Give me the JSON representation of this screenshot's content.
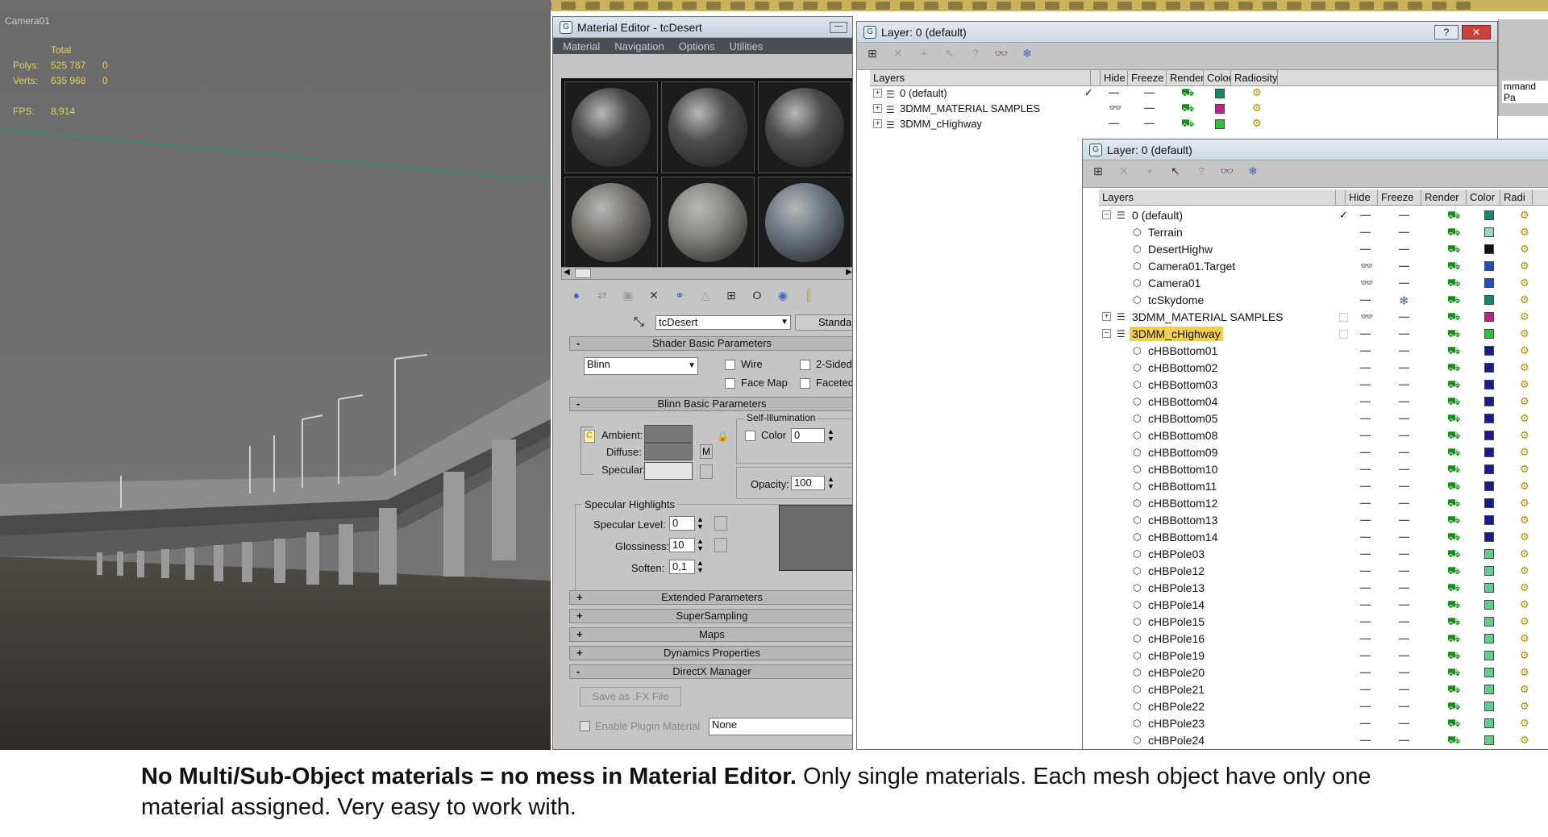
{
  "viewport": {
    "camera_label": "Camera01",
    "stats": {
      "total_label": "Total",
      "polys_label": "Polys:",
      "polys_value": "525 787",
      "polys_sel": "0",
      "verts_label": "Verts:",
      "verts_value": "635 968",
      "verts_sel": "0",
      "fps_label": "FPS:",
      "fps_value": "8,914"
    }
  },
  "material_editor": {
    "title": "Material Editor - tcDesert",
    "menu": [
      "Material",
      "Navigation",
      "Options",
      "Utilities"
    ],
    "material_name": "tcDesert",
    "material_type": "Standa",
    "shader_rollout": "Shader Basic Parameters",
    "shader_value": "Blinn",
    "wire_label": "Wire",
    "two_sided_label": "2-Sided",
    "face_map_label": "Face Map",
    "faceted_label": "Faceted",
    "blinn_rollout": "Blinn Basic Parameters",
    "self_illum_label": "Self-Illumination",
    "color_label": "Color",
    "color_value": "0",
    "ambient_label": "Ambient:",
    "diffuse_label": "Diffuse:",
    "specular_label": "Specular:",
    "m_label": "M",
    "opacity_label": "Opacity:",
    "opacity_value": "100",
    "spec_highlights_label": "Specular Highlights",
    "spec_level_label": "Specular Level:",
    "spec_level_value": "0",
    "glossiness_label": "Glossiness:",
    "glossiness_value": "10",
    "soften_label": "Soften:",
    "soften_value": "0,1",
    "rollouts": [
      {
        "sign": "+",
        "label": "Extended Parameters"
      },
      {
        "sign": "+",
        "label": "SuperSampling"
      },
      {
        "sign": "+",
        "label": "Maps"
      },
      {
        "sign": "+",
        "label": "Dynamics Properties"
      },
      {
        "sign": "-",
        "label": "DirectX Manager"
      }
    ],
    "save_fx_label": "Save as .FX File",
    "enable_plugin_label": "Enable Plugin Material",
    "plugin_value": "None",
    "sphere_colors": [
      "#4a4a4a",
      "#4f4f4f",
      "#4c4c4c",
      "#7a7771",
      "#8a8882",
      "#6e7a88"
    ]
  },
  "layer_back": {
    "title": "Layer: 0 (default)",
    "headers": [
      "Layers",
      "Hide",
      "Freeze",
      "Render",
      "Color",
      "Radiosity"
    ],
    "rows": [
      {
        "name": "0 (default)",
        "current": "✓",
        "hide": "—",
        "freeze": "—",
        "color": "#138a6a"
      },
      {
        "name": "3DMM_MATERIAL SAMPLES",
        "hide": "👓",
        "freeze": "—",
        "color": "#c0208a"
      },
      {
        "name": "3DMM_cHighway",
        "hide": "—",
        "freeze": "—",
        "color": "#2fbf3a"
      }
    ]
  },
  "layer_front": {
    "title": "Layer: 0 (default)",
    "headers": [
      "Layers",
      "Hide",
      "Freeze",
      "Render",
      "Color",
      "Radi"
    ],
    "rows": [
      {
        "name": "0 (default)",
        "level": 0,
        "exp": "−",
        "current": "✓",
        "hide": "—",
        "freeze": "—",
        "color": "#138a6a"
      },
      {
        "name": "Terrain",
        "level": 1,
        "hide": "—",
        "freeze": "—",
        "color": "#9ed9c8"
      },
      {
        "name": "DesertHighw",
        "level": 1,
        "hide": "—",
        "freeze": "—",
        "color": "#111111"
      },
      {
        "name": "Camera01.Target",
        "level": 1,
        "hide": "👓",
        "freeze": "—",
        "color": "#1f4fc4"
      },
      {
        "name": "Camera01",
        "level": 1,
        "hide": "👓",
        "freeze": "—",
        "color": "#1f4fc4"
      },
      {
        "name": "tcSkydome",
        "level": 1,
        "hide": "—",
        "freeze": "❄",
        "color": "#138a6a"
      },
      {
        "name": "3DMM_MATERIAL SAMPLES",
        "level": 0,
        "exp": "+",
        "hide": "👓",
        "freeze": "—",
        "color": "#c0208a"
      },
      {
        "name": "3DMM_cHighway",
        "level": 0,
        "exp": "−",
        "hide": "—",
        "freeze": "—",
        "color": "#2fbf3a",
        "selected": true
      },
      {
        "name": "cHBBottom01",
        "level": 1,
        "hide": "—",
        "freeze": "—",
        "color": "#1a1a8a"
      },
      {
        "name": "cHBBottom02",
        "level": 1,
        "hide": "—",
        "freeze": "—",
        "color": "#1a1a8a"
      },
      {
        "name": "cHBBottom03",
        "level": 1,
        "hide": "—",
        "freeze": "—",
        "color": "#1a1a8a"
      },
      {
        "name": "cHBBottom04",
        "level": 1,
        "hide": "—",
        "freeze": "—",
        "color": "#1a1a8a"
      },
      {
        "name": "cHBBottom05",
        "level": 1,
        "hide": "—",
        "freeze": "—",
        "color": "#1a1a8a"
      },
      {
        "name": "cHBBottom08",
        "level": 1,
        "hide": "—",
        "freeze": "—",
        "color": "#1a1a8a"
      },
      {
        "name": "cHBBottom09",
        "level": 1,
        "hide": "—",
        "freeze": "—",
        "color": "#1a1a8a"
      },
      {
        "name": "cHBBottom10",
        "level": 1,
        "hide": "—",
        "freeze": "—",
        "color": "#1a1a8a"
      },
      {
        "name": "cHBBottom11",
        "level": 1,
        "hide": "—",
        "freeze": "—",
        "color": "#1a1a8a"
      },
      {
        "name": "cHBBottom12",
        "level": 1,
        "hide": "—",
        "freeze": "—",
        "color": "#1a1a8a"
      },
      {
        "name": "cHBBottom13",
        "level": 1,
        "hide": "—",
        "freeze": "—",
        "color": "#1a1a8a"
      },
      {
        "name": "cHBBottom14",
        "level": 1,
        "hide": "—",
        "freeze": "—",
        "color": "#1a1a8a"
      },
      {
        "name": "cHBPole03",
        "level": 1,
        "hide": "—",
        "freeze": "—",
        "color": "#5fd08a"
      },
      {
        "name": "cHBPole12",
        "level": 1,
        "hide": "—",
        "freeze": "—",
        "color": "#5fd08a"
      },
      {
        "name": "cHBPole13",
        "level": 1,
        "hide": "—",
        "freeze": "—",
        "color": "#5fd08a"
      },
      {
        "name": "cHBPole14",
        "level": 1,
        "hide": "—",
        "freeze": "—",
        "color": "#5fd08a"
      },
      {
        "name": "cHBPole15",
        "level": 1,
        "hide": "—",
        "freeze": "—",
        "color": "#5fd08a"
      },
      {
        "name": "cHBPole16",
        "level": 1,
        "hide": "—",
        "freeze": "—",
        "color": "#5fd08a"
      },
      {
        "name": "cHBPole19",
        "level": 1,
        "hide": "—",
        "freeze": "—",
        "color": "#5fd08a"
      },
      {
        "name": "cHBPole20",
        "level": 1,
        "hide": "—",
        "freeze": "—",
        "color": "#5fd08a"
      },
      {
        "name": "cHBPole21",
        "level": 1,
        "hide": "—",
        "freeze": "—",
        "color": "#5fd08a"
      },
      {
        "name": "cHBPole22",
        "level": 1,
        "hide": "—",
        "freeze": "—",
        "color": "#5fd08a"
      },
      {
        "name": "cHBPole23",
        "level": 1,
        "hide": "—",
        "freeze": "—",
        "color": "#5fd08a"
      },
      {
        "name": "cHBPole24",
        "level": 1,
        "hide": "—",
        "freeze": "—",
        "color": "#5fd08a"
      }
    ]
  },
  "command_panel_label": "mmand Pa",
  "caption": {
    "bold": "No Multi/Sub-Object materials = no mess in Material Editor.",
    "rest": " Only single materials. Each mesh object have only one material assigned. Very easy to work with."
  }
}
